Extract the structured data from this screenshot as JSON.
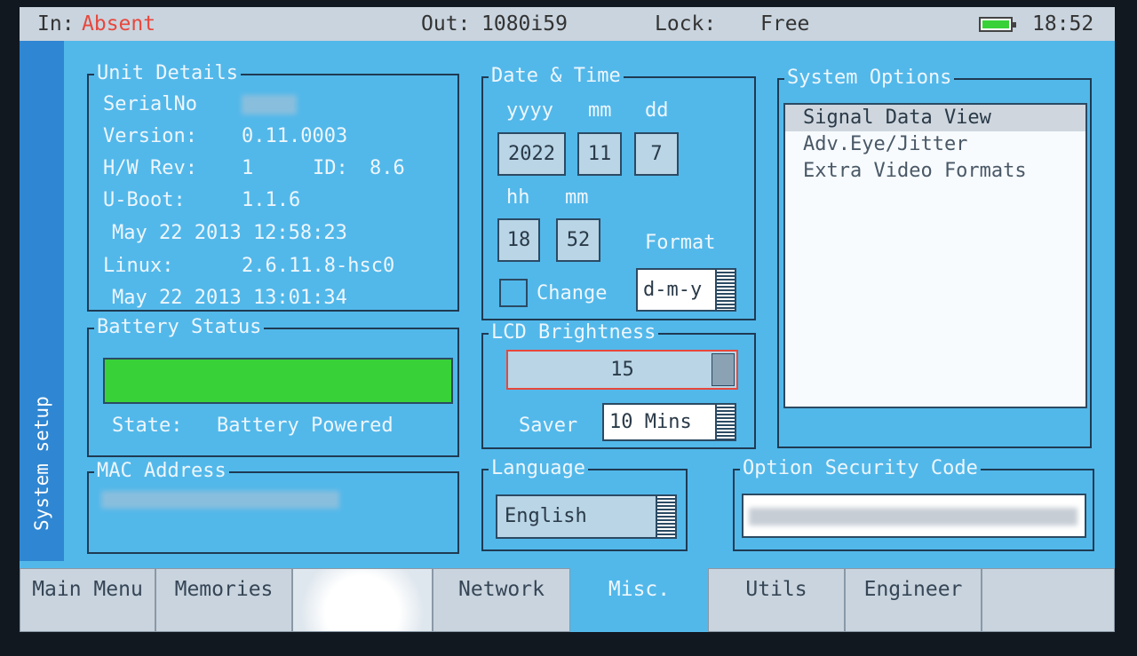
{
  "status_bar": {
    "in_label": "In:",
    "in_value": "Absent",
    "out_label": "Out:",
    "out_value": "1080i59",
    "lock_label": "Lock:",
    "lock_value": "Free",
    "time": "18:52",
    "colors": {
      "absent": "#e8473c",
      "battery_fill": "#38d238"
    }
  },
  "side_tab": {
    "label": "System setup"
  },
  "unit_details": {
    "title": "Unit Details",
    "serial_label": "SerialNo",
    "version_label": "Version:",
    "version_value": "0.11.0003",
    "hw_rev_label": "H/W Rev:",
    "hw_rev_value": "1",
    "id_label": "ID:",
    "id_value": "8.6",
    "uboot_label": "U-Boot:",
    "uboot_value": "1.1.6",
    "uboot_date": "May 22 2013 12:58:23",
    "linux_label": "Linux:",
    "linux_value": "2.6.11.8-hsc0",
    "linux_date": "May 22 2013 13:01:34"
  },
  "battery": {
    "title": "Battery Status",
    "level": 1.0,
    "state_label": "State:",
    "state_value": "Battery Powered"
  },
  "mac": {
    "title": "MAC Address"
  },
  "date_time": {
    "title": "Date & Time",
    "yyyy_label": "yyyy",
    "mm_label": "mm",
    "dd_label": "dd",
    "year": "2022",
    "month": "11",
    "day": "7",
    "hh_label": "hh",
    "min_label": "mm",
    "hour": "18",
    "minute": "52",
    "format_label": "Format",
    "change_label": "Change",
    "format_value": "d-m-y"
  },
  "lcd": {
    "title": "LCD Brightness",
    "brightness": "15",
    "saver_label": "Saver",
    "saver_value": "10 Mins"
  },
  "language": {
    "title": "Language",
    "value": "English"
  },
  "system_options": {
    "title": "System Options",
    "items": [
      "Signal Data View",
      "Adv.Eye/Jitter",
      "Extra Video Formats"
    ]
  },
  "security": {
    "title": "Option Security Code"
  },
  "tabs": [
    "Main Menu",
    "Memories",
    "",
    "Network",
    "Misc.",
    "Utils",
    "Engineer",
    ""
  ]
}
